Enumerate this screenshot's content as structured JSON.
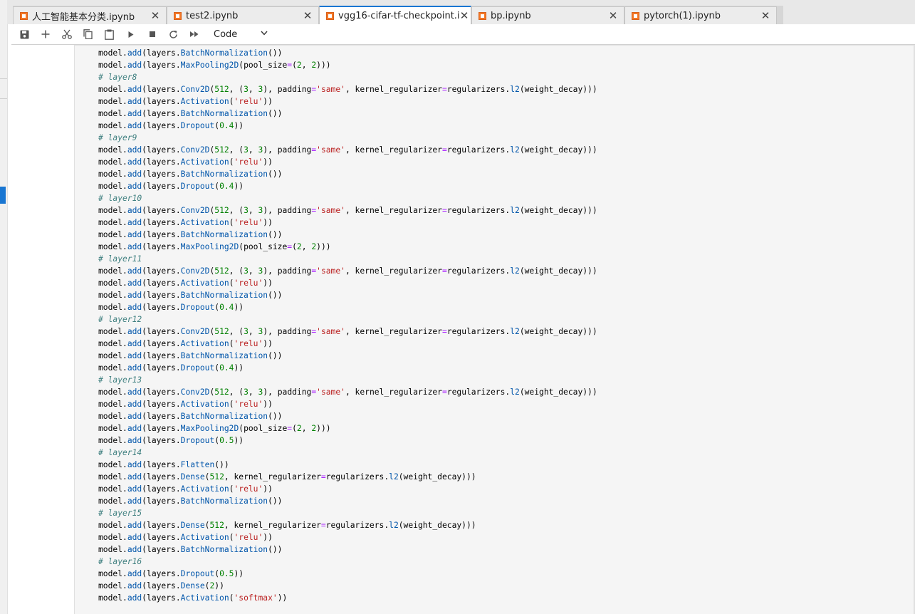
{
  "tabs": [
    {
      "label": "人工智能基本分类.ipynb",
      "active": false
    },
    {
      "label": "test2.ipynb",
      "active": false
    },
    {
      "label": "vgg16-cifar-tf-checkpoint.ipynb",
      "active": true
    },
    {
      "label": "bp.ipynb",
      "active": false
    },
    {
      "label": "pytorch(1).ipynb",
      "active": false
    }
  ],
  "tab_close_glyph": "✕",
  "toolbar": {
    "buttons": [
      "save-icon",
      "add-cell-icon",
      "cut-icon",
      "copy-icon",
      "paste-icon",
      "run-icon",
      "stop-icon",
      "restart-icon",
      "fast-forward-icon"
    ],
    "cell_type": "Code"
  },
  "colors": {
    "accent": "#1976d2",
    "notebook_icon": "#f37726",
    "comment": "#408080",
    "keyword_attr": "#0055aa",
    "string": "#ba2121",
    "number": "#008000",
    "operator": "#aa22ff"
  },
  "code_lines": [
    [
      [
        "t",
        "model."
      ],
      [
        "p",
        "add"
      ],
      [
        "t",
        "(layers."
      ],
      [
        "p",
        "BatchNormalization"
      ],
      [
        "t",
        "())"
      ]
    ],
    [
      [
        "t",
        "model."
      ],
      [
        "p",
        "add"
      ],
      [
        "t",
        "(layers."
      ],
      [
        "p",
        "MaxPooling2D"
      ],
      [
        "t",
        "(pool_size"
      ],
      [
        "o",
        "="
      ],
      [
        "t",
        "("
      ],
      [
        "n",
        "2"
      ],
      [
        "t",
        ", "
      ],
      [
        "n",
        "2"
      ],
      [
        "t",
        ")))"
      ]
    ],
    [
      [
        "c",
        "# layer8"
      ]
    ],
    [
      [
        "t",
        "model."
      ],
      [
        "p",
        "add"
      ],
      [
        "t",
        "(layers."
      ],
      [
        "p",
        "Conv2D"
      ],
      [
        "t",
        "("
      ],
      [
        "n",
        "512"
      ],
      [
        "t",
        ", ("
      ],
      [
        "n",
        "3"
      ],
      [
        "t",
        ", "
      ],
      [
        "n",
        "3"
      ],
      [
        "t",
        "), padding"
      ],
      [
        "o",
        "="
      ],
      [
        "s",
        "'same'"
      ],
      [
        "t",
        ", kernel_regularizer"
      ],
      [
        "o",
        "="
      ],
      [
        "t",
        "regularizers."
      ],
      [
        "p",
        "l2"
      ],
      [
        "t",
        "(weight_decay)))"
      ]
    ],
    [
      [
        "t",
        "model."
      ],
      [
        "p",
        "add"
      ],
      [
        "t",
        "(layers."
      ],
      [
        "p",
        "Activation"
      ],
      [
        "t",
        "("
      ],
      [
        "s",
        "'relu'"
      ],
      [
        "t",
        "))"
      ]
    ],
    [
      [
        "t",
        "model."
      ],
      [
        "p",
        "add"
      ],
      [
        "t",
        "(layers."
      ],
      [
        "p",
        "BatchNormalization"
      ],
      [
        "t",
        "())"
      ]
    ],
    [
      [
        "t",
        "model."
      ],
      [
        "p",
        "add"
      ],
      [
        "t",
        "(layers."
      ],
      [
        "p",
        "Dropout"
      ],
      [
        "t",
        "("
      ],
      [
        "n",
        "0.4"
      ],
      [
        "t",
        "))"
      ]
    ],
    [
      [
        "c",
        "# layer9"
      ]
    ],
    [
      [
        "t",
        "model."
      ],
      [
        "p",
        "add"
      ],
      [
        "t",
        "(layers."
      ],
      [
        "p",
        "Conv2D"
      ],
      [
        "t",
        "("
      ],
      [
        "n",
        "512"
      ],
      [
        "t",
        ", ("
      ],
      [
        "n",
        "3"
      ],
      [
        "t",
        ", "
      ],
      [
        "n",
        "3"
      ],
      [
        "t",
        "), padding"
      ],
      [
        "o",
        "="
      ],
      [
        "s",
        "'same'"
      ],
      [
        "t",
        ", kernel_regularizer"
      ],
      [
        "o",
        "="
      ],
      [
        "t",
        "regularizers."
      ],
      [
        "p",
        "l2"
      ],
      [
        "t",
        "(weight_decay)))"
      ]
    ],
    [
      [
        "t",
        "model."
      ],
      [
        "p",
        "add"
      ],
      [
        "t",
        "(layers."
      ],
      [
        "p",
        "Activation"
      ],
      [
        "t",
        "("
      ],
      [
        "s",
        "'relu'"
      ],
      [
        "t",
        "))"
      ]
    ],
    [
      [
        "t",
        "model."
      ],
      [
        "p",
        "add"
      ],
      [
        "t",
        "(layers."
      ],
      [
        "p",
        "BatchNormalization"
      ],
      [
        "t",
        "())"
      ]
    ],
    [
      [
        "t",
        "model."
      ],
      [
        "p",
        "add"
      ],
      [
        "t",
        "(layers."
      ],
      [
        "p",
        "Dropout"
      ],
      [
        "t",
        "("
      ],
      [
        "n",
        "0.4"
      ],
      [
        "t",
        "))"
      ]
    ],
    [
      [
        "c",
        "# layer10"
      ]
    ],
    [
      [
        "t",
        "model."
      ],
      [
        "p",
        "add"
      ],
      [
        "t",
        "(layers."
      ],
      [
        "p",
        "Conv2D"
      ],
      [
        "t",
        "("
      ],
      [
        "n",
        "512"
      ],
      [
        "t",
        ", ("
      ],
      [
        "n",
        "3"
      ],
      [
        "t",
        ", "
      ],
      [
        "n",
        "3"
      ],
      [
        "t",
        "), padding"
      ],
      [
        "o",
        "="
      ],
      [
        "s",
        "'same'"
      ],
      [
        "t",
        ", kernel_regularizer"
      ],
      [
        "o",
        "="
      ],
      [
        "t",
        "regularizers."
      ],
      [
        "p",
        "l2"
      ],
      [
        "t",
        "(weight_decay)))"
      ]
    ],
    [
      [
        "t",
        "model."
      ],
      [
        "p",
        "add"
      ],
      [
        "t",
        "(layers."
      ],
      [
        "p",
        "Activation"
      ],
      [
        "t",
        "("
      ],
      [
        "s",
        "'relu'"
      ],
      [
        "t",
        "))"
      ]
    ],
    [
      [
        "t",
        "model."
      ],
      [
        "p",
        "add"
      ],
      [
        "t",
        "(layers."
      ],
      [
        "p",
        "BatchNormalization"
      ],
      [
        "t",
        "())"
      ]
    ],
    [
      [
        "t",
        "model."
      ],
      [
        "p",
        "add"
      ],
      [
        "t",
        "(layers."
      ],
      [
        "p",
        "MaxPooling2D"
      ],
      [
        "t",
        "(pool_size"
      ],
      [
        "o",
        "="
      ],
      [
        "t",
        "("
      ],
      [
        "n",
        "2"
      ],
      [
        "t",
        ", "
      ],
      [
        "n",
        "2"
      ],
      [
        "t",
        ")))"
      ]
    ],
    [
      [
        "c",
        "# layer11"
      ]
    ],
    [
      [
        "t",
        "model."
      ],
      [
        "p",
        "add"
      ],
      [
        "t",
        "(layers."
      ],
      [
        "p",
        "Conv2D"
      ],
      [
        "t",
        "("
      ],
      [
        "n",
        "512"
      ],
      [
        "t",
        ", ("
      ],
      [
        "n",
        "3"
      ],
      [
        "t",
        ", "
      ],
      [
        "n",
        "3"
      ],
      [
        "t",
        "), padding"
      ],
      [
        "o",
        "="
      ],
      [
        "s",
        "'same'"
      ],
      [
        "t",
        ", kernel_regularizer"
      ],
      [
        "o",
        "="
      ],
      [
        "t",
        "regularizers."
      ],
      [
        "p",
        "l2"
      ],
      [
        "t",
        "(weight_decay)))"
      ]
    ],
    [
      [
        "t",
        "model."
      ],
      [
        "p",
        "add"
      ],
      [
        "t",
        "(layers."
      ],
      [
        "p",
        "Activation"
      ],
      [
        "t",
        "("
      ],
      [
        "s",
        "'relu'"
      ],
      [
        "t",
        "))"
      ]
    ],
    [
      [
        "t",
        "model."
      ],
      [
        "p",
        "add"
      ],
      [
        "t",
        "(layers."
      ],
      [
        "p",
        "BatchNormalization"
      ],
      [
        "t",
        "())"
      ]
    ],
    [
      [
        "t",
        "model."
      ],
      [
        "p",
        "add"
      ],
      [
        "t",
        "(layers."
      ],
      [
        "p",
        "Dropout"
      ],
      [
        "t",
        "("
      ],
      [
        "n",
        "0.4"
      ],
      [
        "t",
        "))"
      ]
    ],
    [
      [
        "c",
        "# layer12"
      ]
    ],
    [
      [
        "t",
        "model."
      ],
      [
        "p",
        "add"
      ],
      [
        "t",
        "(layers."
      ],
      [
        "p",
        "Conv2D"
      ],
      [
        "t",
        "("
      ],
      [
        "n",
        "512"
      ],
      [
        "t",
        ", ("
      ],
      [
        "n",
        "3"
      ],
      [
        "t",
        ", "
      ],
      [
        "n",
        "3"
      ],
      [
        "t",
        "), padding"
      ],
      [
        "o",
        "="
      ],
      [
        "s",
        "'same'"
      ],
      [
        "t",
        ", kernel_regularizer"
      ],
      [
        "o",
        "="
      ],
      [
        "t",
        "regularizers."
      ],
      [
        "p",
        "l2"
      ],
      [
        "t",
        "(weight_decay)))"
      ]
    ],
    [
      [
        "t",
        "model."
      ],
      [
        "p",
        "add"
      ],
      [
        "t",
        "(layers."
      ],
      [
        "p",
        "Activation"
      ],
      [
        "t",
        "("
      ],
      [
        "s",
        "'relu'"
      ],
      [
        "t",
        "))"
      ]
    ],
    [
      [
        "t",
        "model."
      ],
      [
        "p",
        "add"
      ],
      [
        "t",
        "(layers."
      ],
      [
        "p",
        "BatchNormalization"
      ],
      [
        "t",
        "())"
      ]
    ],
    [
      [
        "t",
        "model."
      ],
      [
        "p",
        "add"
      ],
      [
        "t",
        "(layers."
      ],
      [
        "p",
        "Dropout"
      ],
      [
        "t",
        "("
      ],
      [
        "n",
        "0.4"
      ],
      [
        "t",
        "))"
      ]
    ],
    [
      [
        "c",
        "# layer13"
      ]
    ],
    [
      [
        "t",
        "model."
      ],
      [
        "p",
        "add"
      ],
      [
        "t",
        "(layers."
      ],
      [
        "p",
        "Conv2D"
      ],
      [
        "t",
        "("
      ],
      [
        "n",
        "512"
      ],
      [
        "t",
        ", ("
      ],
      [
        "n",
        "3"
      ],
      [
        "t",
        ", "
      ],
      [
        "n",
        "3"
      ],
      [
        "t",
        "), padding"
      ],
      [
        "o",
        "="
      ],
      [
        "s",
        "'same'"
      ],
      [
        "t",
        ", kernel_regularizer"
      ],
      [
        "o",
        "="
      ],
      [
        "t",
        "regularizers."
      ],
      [
        "p",
        "l2"
      ],
      [
        "t",
        "(weight_decay)))"
      ]
    ],
    [
      [
        "t",
        "model."
      ],
      [
        "p",
        "add"
      ],
      [
        "t",
        "(layers."
      ],
      [
        "p",
        "Activation"
      ],
      [
        "t",
        "("
      ],
      [
        "s",
        "'relu'"
      ],
      [
        "t",
        "))"
      ]
    ],
    [
      [
        "t",
        "model."
      ],
      [
        "p",
        "add"
      ],
      [
        "t",
        "(layers."
      ],
      [
        "p",
        "BatchNormalization"
      ],
      [
        "t",
        "())"
      ]
    ],
    [
      [
        "t",
        "model."
      ],
      [
        "p",
        "add"
      ],
      [
        "t",
        "(layers."
      ],
      [
        "p",
        "MaxPooling2D"
      ],
      [
        "t",
        "(pool_size"
      ],
      [
        "o",
        "="
      ],
      [
        "t",
        "("
      ],
      [
        "n",
        "2"
      ],
      [
        "t",
        ", "
      ],
      [
        "n",
        "2"
      ],
      [
        "t",
        ")))"
      ]
    ],
    [
      [
        "t",
        "model."
      ],
      [
        "p",
        "add"
      ],
      [
        "t",
        "(layers."
      ],
      [
        "p",
        "Dropout"
      ],
      [
        "t",
        "("
      ],
      [
        "n",
        "0.5"
      ],
      [
        "t",
        "))"
      ]
    ],
    [
      [
        "c",
        "# layer14"
      ]
    ],
    [
      [
        "t",
        "model."
      ],
      [
        "p",
        "add"
      ],
      [
        "t",
        "(layers."
      ],
      [
        "p",
        "Flatten"
      ],
      [
        "t",
        "())"
      ]
    ],
    [
      [
        "t",
        "model."
      ],
      [
        "p",
        "add"
      ],
      [
        "t",
        "(layers."
      ],
      [
        "p",
        "Dense"
      ],
      [
        "t",
        "("
      ],
      [
        "n",
        "512"
      ],
      [
        "t",
        ", kernel_regularizer"
      ],
      [
        "o",
        "="
      ],
      [
        "t",
        "regularizers."
      ],
      [
        "p",
        "l2"
      ],
      [
        "t",
        "(weight_decay)))"
      ]
    ],
    [
      [
        "t",
        "model."
      ],
      [
        "p",
        "add"
      ],
      [
        "t",
        "(layers."
      ],
      [
        "p",
        "Activation"
      ],
      [
        "t",
        "("
      ],
      [
        "s",
        "'relu'"
      ],
      [
        "t",
        "))"
      ]
    ],
    [
      [
        "t",
        "model."
      ],
      [
        "p",
        "add"
      ],
      [
        "t",
        "(layers."
      ],
      [
        "p",
        "BatchNormalization"
      ],
      [
        "t",
        "())"
      ]
    ],
    [
      [
        "c",
        "# layer15"
      ]
    ],
    [
      [
        "t",
        "model."
      ],
      [
        "p",
        "add"
      ],
      [
        "t",
        "(layers."
      ],
      [
        "p",
        "Dense"
      ],
      [
        "t",
        "("
      ],
      [
        "n",
        "512"
      ],
      [
        "t",
        ", kernel_regularizer"
      ],
      [
        "o",
        "="
      ],
      [
        "t",
        "regularizers."
      ],
      [
        "p",
        "l2"
      ],
      [
        "t",
        "(weight_decay)))"
      ]
    ],
    [
      [
        "t",
        "model."
      ],
      [
        "p",
        "add"
      ],
      [
        "t",
        "(layers."
      ],
      [
        "p",
        "Activation"
      ],
      [
        "t",
        "("
      ],
      [
        "s",
        "'relu'"
      ],
      [
        "t",
        "))"
      ]
    ],
    [
      [
        "t",
        "model."
      ],
      [
        "p",
        "add"
      ],
      [
        "t",
        "(layers."
      ],
      [
        "p",
        "BatchNormalization"
      ],
      [
        "t",
        "())"
      ]
    ],
    [
      [
        "c",
        "# layer16"
      ]
    ],
    [
      [
        "t",
        "model."
      ],
      [
        "p",
        "add"
      ],
      [
        "t",
        "(layers."
      ],
      [
        "p",
        "Dropout"
      ],
      [
        "t",
        "("
      ],
      [
        "n",
        "0.5"
      ],
      [
        "t",
        "))"
      ]
    ],
    [
      [
        "t",
        "model."
      ],
      [
        "p",
        "add"
      ],
      [
        "t",
        "(layers."
      ],
      [
        "p",
        "Dense"
      ],
      [
        "t",
        "("
      ],
      [
        "n",
        "2"
      ],
      [
        "t",
        "))"
      ]
    ],
    [
      [
        "t",
        "model."
      ],
      [
        "p",
        "add"
      ],
      [
        "t",
        "(layers."
      ],
      [
        "p",
        "Activation"
      ],
      [
        "t",
        "("
      ],
      [
        "s",
        "'softmax'"
      ],
      [
        "t",
        "))"
      ]
    ]
  ]
}
